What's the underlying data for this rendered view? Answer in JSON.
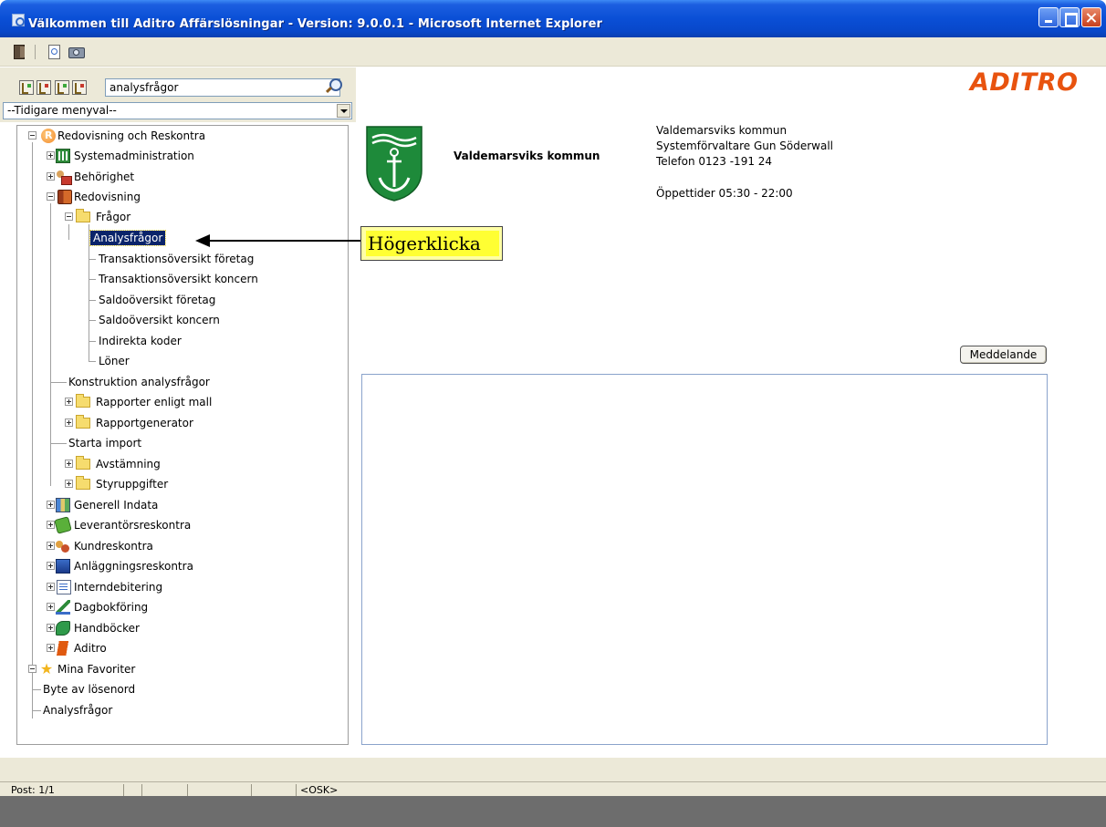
{
  "window": {
    "title": "Välkommen till Aditro Affärslösningar - Version: 9.0.0.1 - Microsoft Internet Explorer"
  },
  "search": {
    "value": "analysfrågor"
  },
  "menu_history": {
    "selected": "--Tidigare menyval--"
  },
  "tree": {
    "root": "Redovisning och Reskontra",
    "systemadmin": "Systemadministration",
    "behorighet": "Behörighet",
    "redovisning": "Redovisning",
    "fragor": "Frågor",
    "fragor_children": [
      "Analysfrågor",
      "Transaktionsöversikt företag",
      "Transaktionsöversikt koncern",
      "Saldoöversikt företag",
      "Saldoöversikt koncern",
      "Indirekta koder",
      "Löner"
    ],
    "konstruktion": "Konstruktion analysfrågor",
    "rapporter_mall": "Rapporter enligt mall",
    "rapportgenerator": "Rapportgenerator",
    "starta_import": "Starta import",
    "avstamning": "Avstämning",
    "styruppgifter": "Styruppgifter",
    "generell_indata": "Generell Indata",
    "leverantorsreskontra": "Leverantörsreskontra",
    "kundreskontra": "Kundreskontra",
    "anlaggningsreskontra": "Anläggningsreskontra",
    "interndebitering": "Interndebitering",
    "dagbokforing": "Dagbokföring",
    "handbocker": "Handböcker",
    "aditro": "Aditro",
    "favoriter": "Mina Favoriter",
    "favoriter_children": [
      "Byte av lösenord",
      "Analysfrågor"
    ]
  },
  "header": {
    "logo_text": "ADITRO",
    "municipality": "Valdemarsviks kommun",
    "info": {
      "line1": "Valdemarsviks kommun",
      "line2": "Systemförvaltare Gun Söderwall",
      "line3": "Telefon 0123 -191 24",
      "line4": "Öppettider 05:30 - 22:00"
    }
  },
  "callout": {
    "text": "Högerklicka"
  },
  "messages": {
    "button_label": "Meddelande"
  },
  "status": {
    "post": "Post: 1/1",
    "osk": "<OSK>"
  }
}
